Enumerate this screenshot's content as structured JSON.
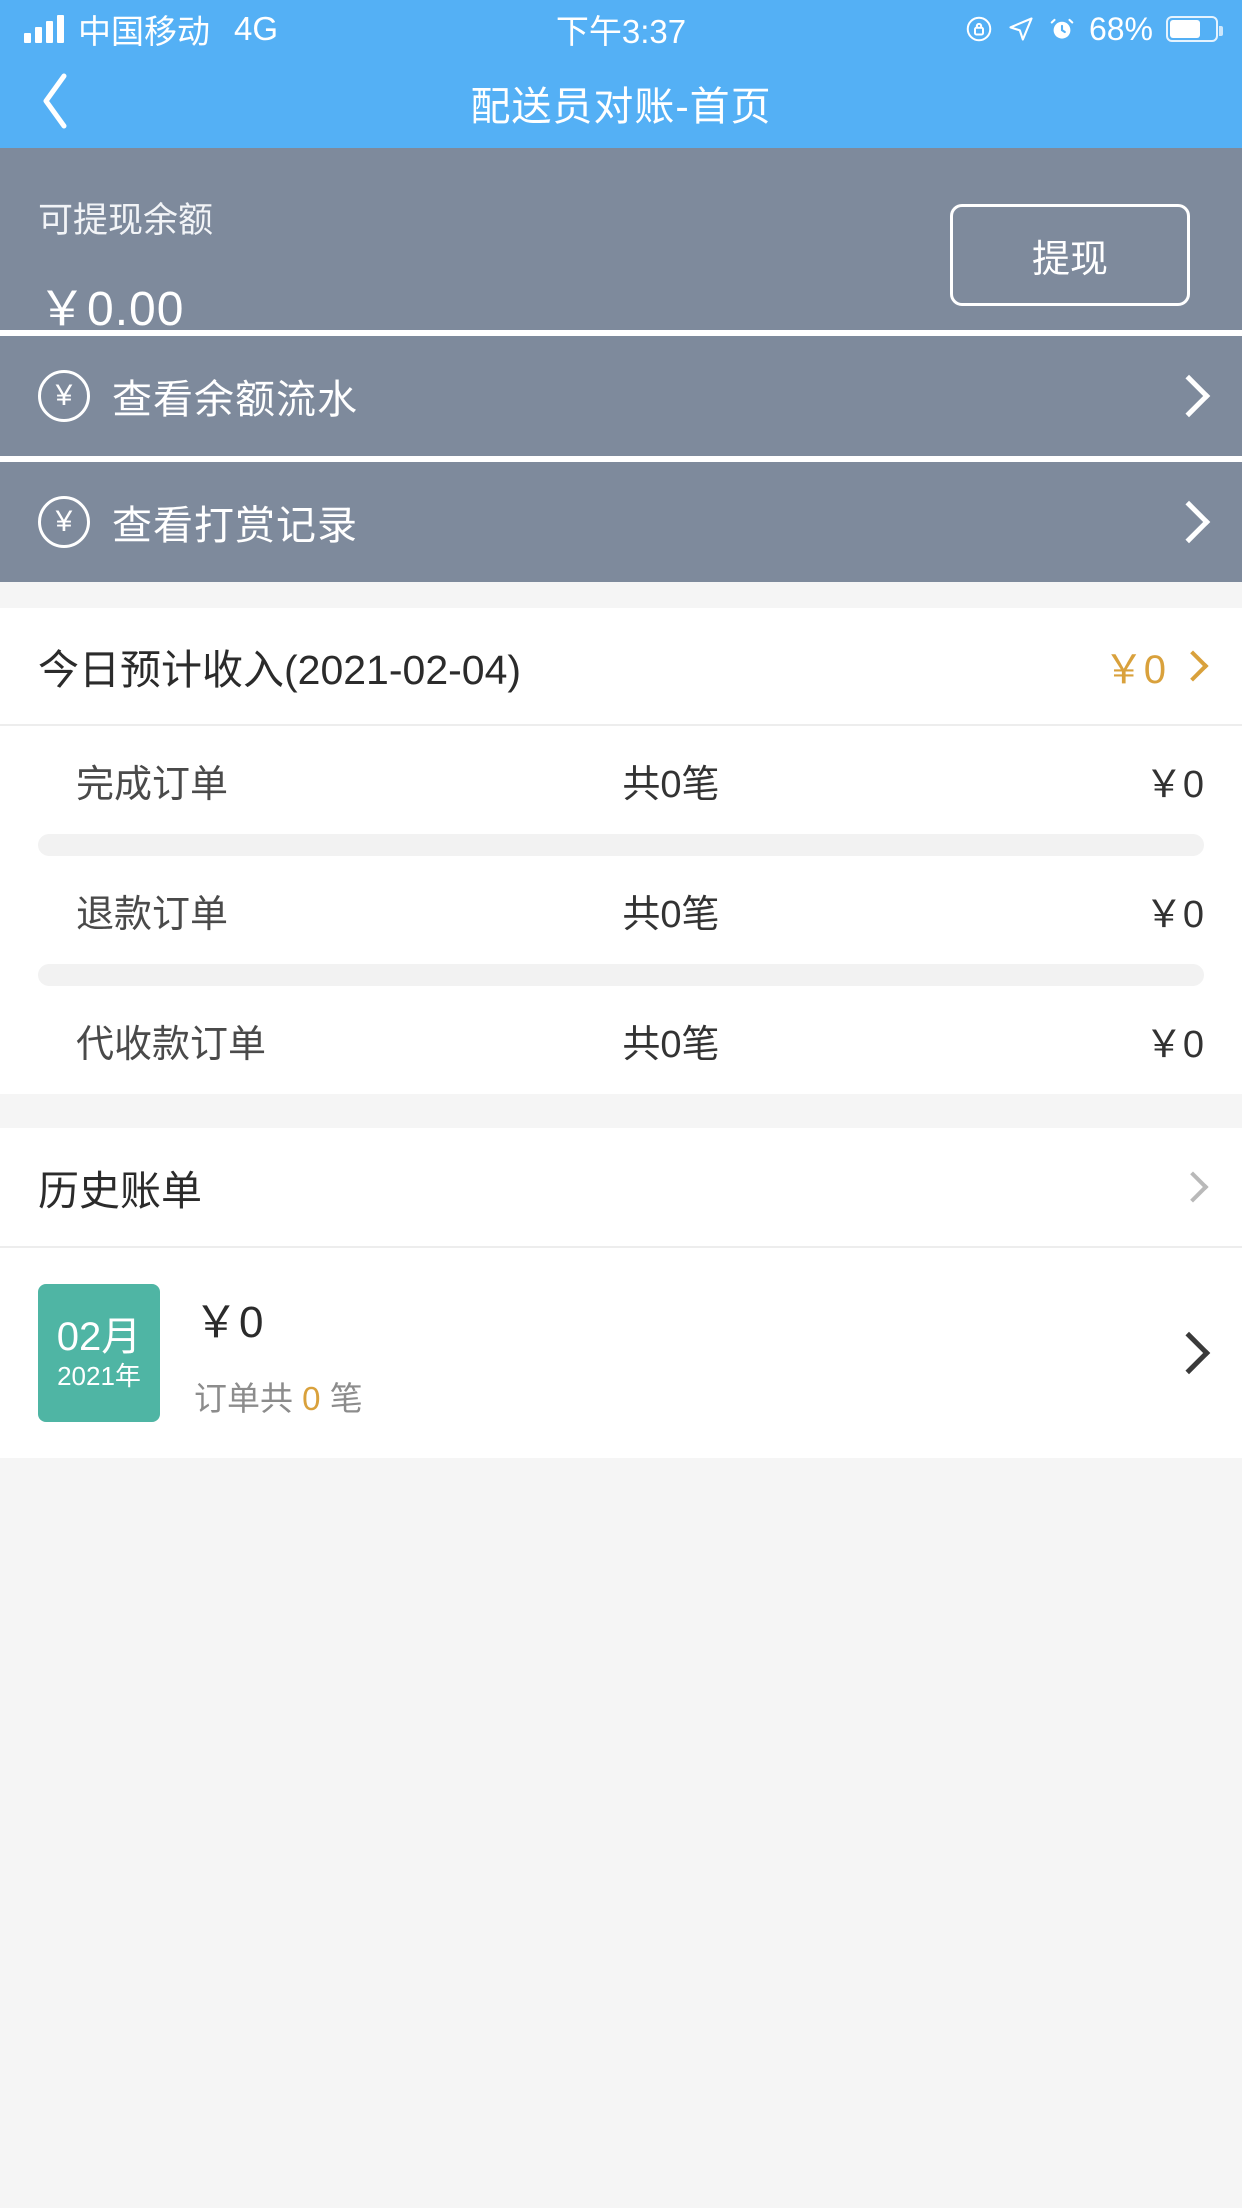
{
  "statusbar": {
    "carrier": "中国移动",
    "network": "4G",
    "time": "下午3:37",
    "battery_percent": "68%",
    "icons": [
      "signal-bars-icon",
      "rotation-lock-icon",
      "location-arrow-icon",
      "alarm-clock-icon",
      "battery-icon"
    ]
  },
  "navbar": {
    "back_icon": "chevron-left-icon",
    "title": "配送员对账-首页"
  },
  "balance": {
    "label": "可提现余额",
    "amount": "￥0.00",
    "withdraw_label": "提现"
  },
  "gray_menu": [
    {
      "icon": "yen-circle-icon",
      "label": "查看余额流水",
      "chevron": "chevron-right-icon"
    },
    {
      "icon": "yen-circle-icon",
      "label": "查看打赏记录",
      "chevron": "chevron-right-icon"
    }
  ],
  "today_income": {
    "title": "今日预计收入(2021-02-04)",
    "amount": "￥0",
    "chevron": "chevron-right-icon",
    "rows": [
      {
        "name": "完成订单",
        "count": "共0笔",
        "amount": "￥0"
      },
      {
        "name": "退款订单",
        "count": "共0笔",
        "amount": "￥0"
      },
      {
        "name": "代收款订单",
        "count": "共0笔",
        "amount": "￥0"
      }
    ]
  },
  "history": {
    "title": "历史账单",
    "chevron": "chevron-right-icon",
    "months": [
      {
        "month": "02月",
        "year": "2021年",
        "amount": "￥0",
        "sub_prefix": "订单共",
        "sub_count": "0",
        "sub_suffix": "笔",
        "chevron": "chevron-right-icon"
      }
    ]
  },
  "colors": {
    "brand_blue": "#54b0f5",
    "panel_gray": "#7e8a9c",
    "accent_gold": "#d9a13c",
    "badge_teal": "#4fb5a4",
    "page_bg": "#f5f5f5"
  }
}
